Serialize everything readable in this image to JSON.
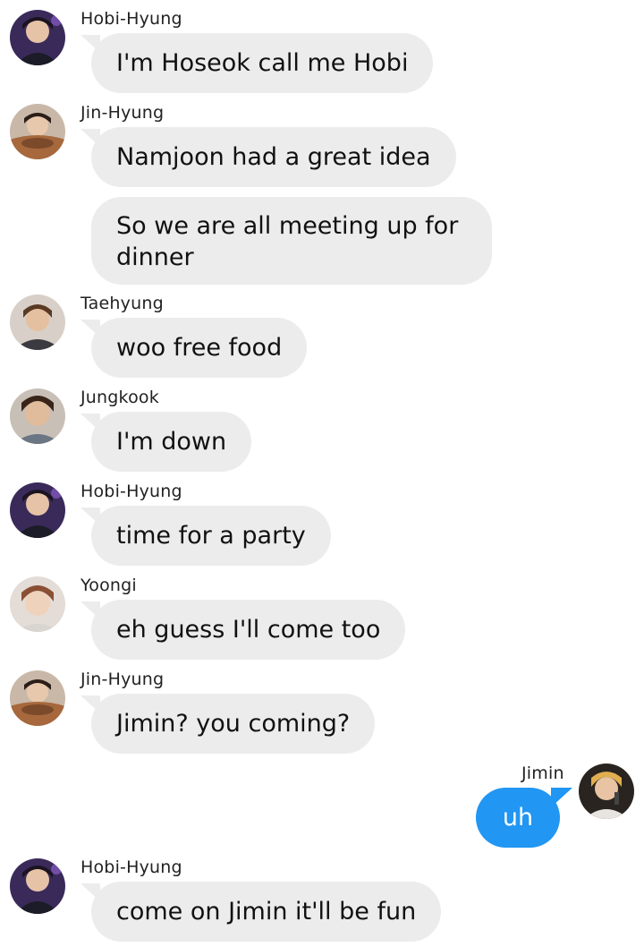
{
  "app": {
    "accent_color": "#2196f3",
    "bubble_color": "#ececec"
  },
  "messages": [
    {
      "sender": "Hobi-Hyung",
      "avatar": "hobi-avatar",
      "text": "I'm Hoseok call me Hobi"
    },
    {
      "sender": "Jin-Hyung",
      "avatar": "jin-avatar",
      "text": "Namjoon had a great idea"
    },
    {
      "sender": "",
      "avatar": "",
      "text": "So we are all meeting up for dinner"
    },
    {
      "sender": "Taehyung",
      "avatar": "taehyung-avatar",
      "text": "woo free food"
    },
    {
      "sender": "Jungkook",
      "avatar": "jungkook-avatar",
      "text": "I'm down"
    },
    {
      "sender": "Hobi-Hyung",
      "avatar": "hobi-avatar",
      "text": "time for a party"
    },
    {
      "sender": "Yoongi",
      "avatar": "yoongi-avatar",
      "text": "eh guess I'll come too"
    },
    {
      "sender": "Jin-Hyung",
      "avatar": "jin-avatar",
      "text": "Jimin? you coming?"
    },
    {
      "sender": "Jimin",
      "avatar": "jimin-avatar",
      "text": "uh",
      "outgoing": true
    },
    {
      "sender": "Hobi-Hyung",
      "avatar": "hobi-avatar",
      "text": "come on Jimin it'll be fun"
    }
  ]
}
